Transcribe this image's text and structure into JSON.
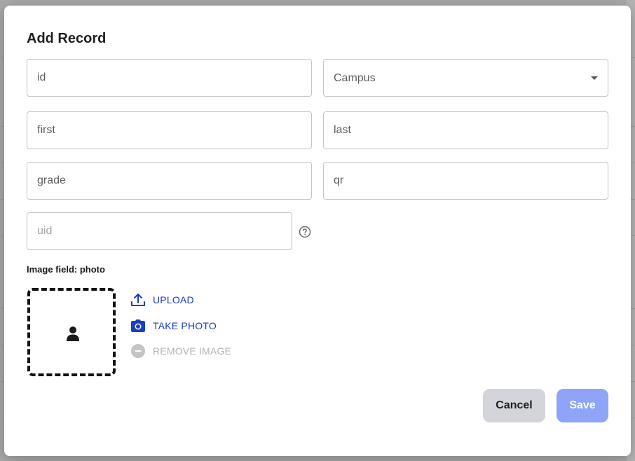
{
  "dialog": {
    "title": "Add Record",
    "fields": {
      "id": {
        "placeholder": "id"
      },
      "campus": {
        "value": "Campus"
      },
      "first": {
        "placeholder": "first"
      },
      "last": {
        "placeholder": "last"
      },
      "grade": {
        "placeholder": "grade"
      },
      "qr": {
        "placeholder": "qr"
      },
      "uid": {
        "placeholder": "uid"
      }
    },
    "image_field": {
      "label": "Image field: photo",
      "upload_label": "UPLOAD",
      "take_photo_label": "TAKE PHOTO",
      "remove_label": "REMOVE IMAGE"
    },
    "actions": {
      "cancel_label": "Cancel",
      "save_label": "Save"
    }
  },
  "colors": {
    "accent": "#1a3fbf",
    "save_button": "#8fa3f7",
    "cancel_button": "#d3d5da",
    "overlay": "#a9a9a9"
  },
  "icons": {
    "help": "help-circle-icon",
    "avatar": "person-icon",
    "upload": "upload-icon",
    "camera": "camera-icon",
    "remove": "remove-circle-icon",
    "dropdown": "caret-down-icon"
  }
}
